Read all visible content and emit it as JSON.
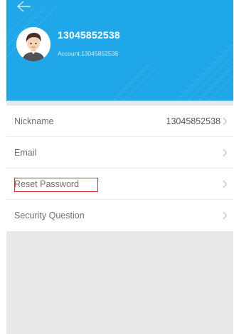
{
  "header": {
    "back_icon": "back-arrow-icon",
    "username": "13045852538",
    "account_line": "Account:13045852538",
    "background_color": "#20a7e9"
  },
  "menu": {
    "items": [
      {
        "label": "Nickname",
        "value": "13045852538"
      },
      {
        "label": "Email",
        "value": ""
      },
      {
        "label": "Reset Password",
        "value": ""
      },
      {
        "label": "Security Question",
        "value": ""
      }
    ],
    "chevron_icon": "chevron-right-icon",
    "highlight_color": "#e03030"
  }
}
